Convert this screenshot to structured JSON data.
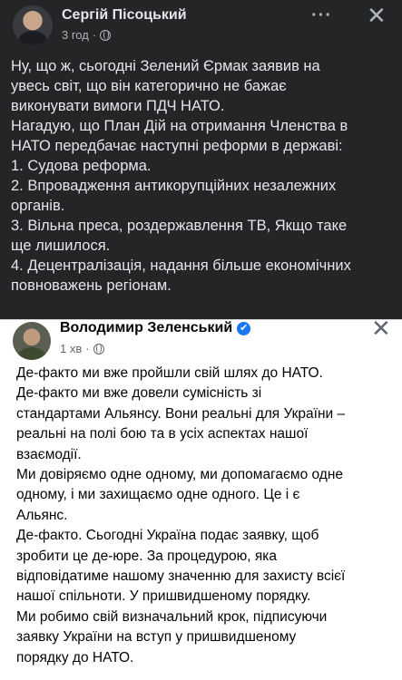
{
  "outer_post": {
    "author": "Сергій Пісоцький",
    "time": "3 год",
    "privacy_icon": "globe-icon",
    "more_icon": "···",
    "close_icon": "✕",
    "lines": [
      "Ну, що ж, сьогодні Зелений Єрмак заявив на",
      "увесь світ, що він категорично не бажає",
      "виконувати вимоги ПДЧ НАТО.",
      "Нагадую, що План Дій на отримання Членства в",
      "НАТО передбачає наступні реформи в державі:",
      "1. Судова реформа.",
      "2. Впровадження антикорупційних незалежних",
      "органів.",
      "3. Вільна преса, роздержавлення ТВ, Якщо таке",
      "ще лишилося.",
      "4. Децентралізація, надання більше економічних",
      "повноважень регіонам."
    ]
  },
  "inner_post": {
    "author": "Володимир Зеленський",
    "verified_icon": "✔",
    "time": "1 хв",
    "privacy_icon": "globe-icon",
    "close_icon": "✕",
    "lines": [
      "Де-факто ми вже пройшли свій шлях до НАТО.",
      "Де-факто ми вже довели сумісність зі",
      "стандартами Альянсу. Вони реальні для України –",
      "реальні на полі бою та в усіх аспектах нашої",
      "взаємодії.",
      "Ми довіряємо одне одному, ми допомагаємо одне",
      "одному, і ми захищаємо одне одного. Це і є",
      "Альянс.",
      "Де-факто. Сьогодні Україна подає заявку, щоб",
      "зробити це де-юре. За процедурою, яка",
      "відповідатиме нашому значенню для захисту всієї",
      "нашої спільноти. У пришвидшеному порядку.",
      "Ми робимо свій визначальний крок, підписуючи",
      "заявку України на вступ у пришвидшеному",
      "порядку до НАТО."
    ]
  },
  "colors": {
    "outer_bg": "#242526",
    "outer_text": "#e4e6eb",
    "inner_bg": "#ffffff",
    "verified_blue": "#1877f2"
  }
}
